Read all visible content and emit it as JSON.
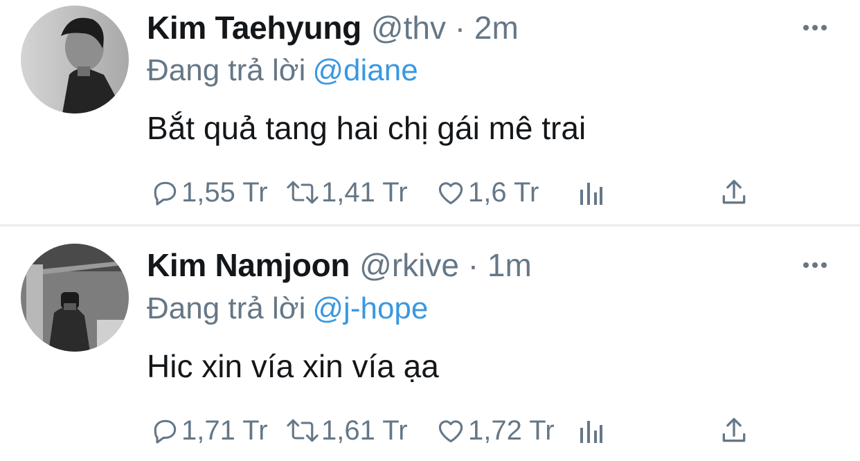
{
  "tweets": [
    {
      "name": "Kim Taehyung",
      "handle": "@thv",
      "separator": "·",
      "time": "2m",
      "replying_label": "Đang trả lời",
      "replying_to": "@diane",
      "text": "Bắt quả tang hai chị gái mê trai",
      "replies": "1,55 Tr",
      "retweets": "1,41 Tr",
      "likes": "1,6 Tr",
      "icons": {
        "more": "more-horizontal-icon",
        "reply": "speech-bubble-icon",
        "retweet": "retweet-icon",
        "like": "heart-icon",
        "views": "bar-chart-icon",
        "share": "share-arrow-icon"
      }
    },
    {
      "name": "Kim Namjoon",
      "handle": "@rkive",
      "separator": "·",
      "time": "1m",
      "replying_label": "Đang trả lời",
      "replying_to": "@j-hope",
      "text": "Hic xin vía xin vía ạa",
      "replies": "1,71 Tr",
      "retweets": "1,61 Tr",
      "likes": "1,72 Tr",
      "icons": {
        "more": "more-horizontal-icon",
        "reply": "speech-bubble-icon",
        "retweet": "retweet-icon",
        "like": "heart-icon",
        "views": "bar-chart-icon",
        "share": "share-arrow-icon"
      }
    }
  ],
  "colors": {
    "text": "#14171a",
    "secondary": "#657786",
    "link": "#3a98e0",
    "divider": "#e9ecef"
  }
}
